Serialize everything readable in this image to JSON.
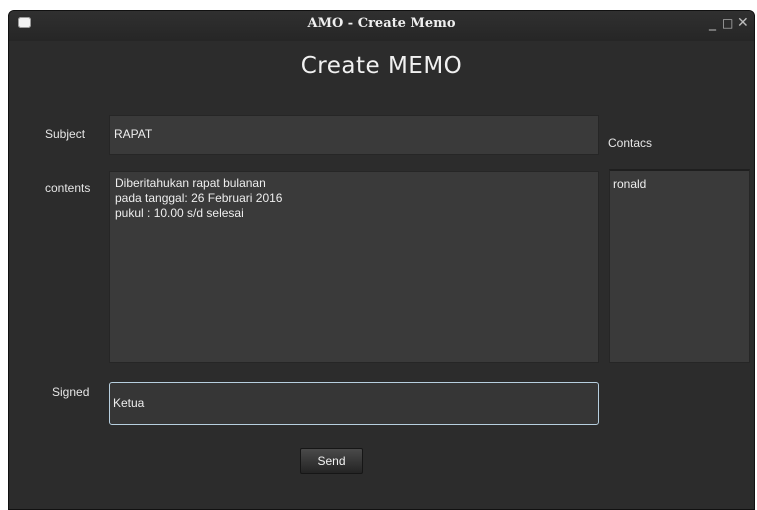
{
  "window": {
    "title": "AMO - Create Memo",
    "min_glyph": "_",
    "max_glyph": "□",
    "close_glyph": "✕"
  },
  "form": {
    "heading": "Create MEMO",
    "subject_label": "Subject",
    "subject_value": "RAPAT",
    "contents_label": "contents",
    "contents_lines": [
      "Diberitahukan rapat bulanan",
      "pada tanggal: 26 Februari 2016",
      "pukul : 10.00 s/d selesai"
    ],
    "contacts_label": "Contacs",
    "contacts": [
      "ronald"
    ],
    "signed_label": "Signed",
    "signed_value": "Ketua",
    "send_label": "Send"
  },
  "colors": {
    "window_bg": "#2c2c2c",
    "field_bg": "#3a3a3a",
    "focus_border": "#b7cfdf",
    "text": "#eeeeee"
  }
}
